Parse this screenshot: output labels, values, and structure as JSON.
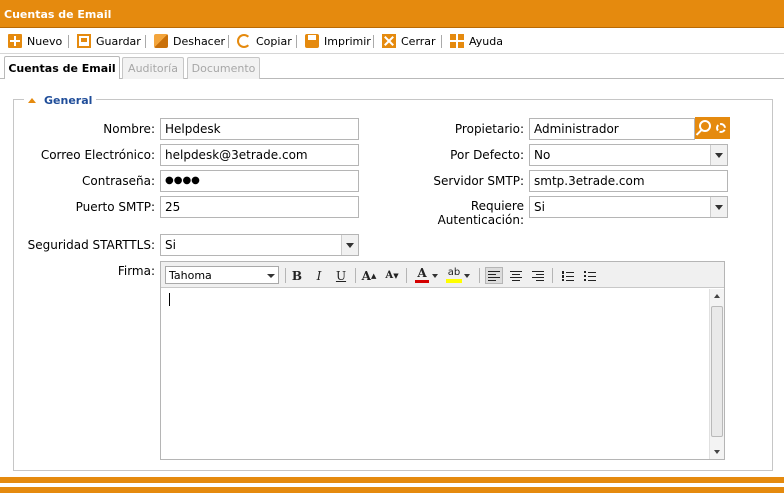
{
  "window": {
    "title": "Cuentas de Email"
  },
  "toolbar": {
    "nuevo": "Nuevo",
    "guardar": "Guardar",
    "deshacer": "Deshacer",
    "copiar": "Copiar",
    "imprimir": "Imprimir",
    "cerrar": "Cerrar",
    "ayuda": "Ayuda"
  },
  "tabs": [
    {
      "label": "Cuentas de Email",
      "active": true
    },
    {
      "label": "Auditoría",
      "active": false
    },
    {
      "label": "Documento",
      "active": false
    }
  ],
  "section": {
    "title": "General"
  },
  "form": {
    "nombre": {
      "label": "Nombre:",
      "value": "Helpdesk"
    },
    "correo": {
      "label": "Correo Electrónico:",
      "value": "helpdesk@3etrade.com"
    },
    "contrasena": {
      "label": "Contraseña:",
      "value": "●●●●"
    },
    "puerto": {
      "label": "Puerto SMTP:",
      "value": "25"
    },
    "seguridad": {
      "label": "Seguridad STARTTLS:",
      "value": "Si"
    },
    "firma": {
      "label": "Firma:"
    },
    "propietario": {
      "label": "Propietario:",
      "value": "Administrador"
    },
    "por_defecto": {
      "label": "Por Defecto:",
      "value": "No"
    },
    "servidor": {
      "label": "Servidor SMTP:",
      "value": "smtp.3etrade.com"
    },
    "requiere_1": "Requiere",
    "requiere_2": "Autenticación:",
    "requiere_value": "Si"
  },
  "editor": {
    "font": "Tahoma",
    "bold": "B",
    "italic": "I",
    "underline": "U",
    "grow": "A",
    "shrink": "A",
    "fontcolor": "A",
    "highlight": "ab"
  },
  "colors": {
    "accent": "#e58a0e",
    "link": "#1f4d99"
  }
}
